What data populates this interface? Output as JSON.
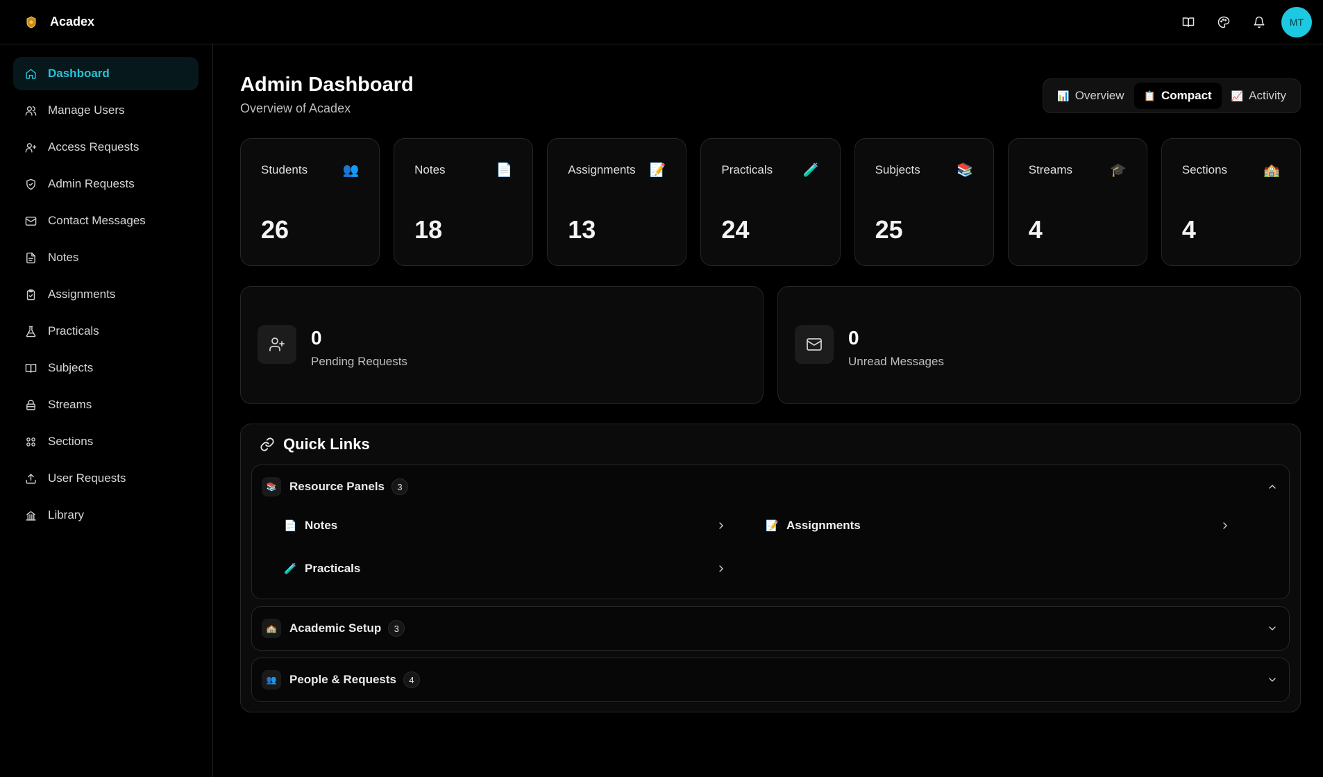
{
  "app": {
    "name": "Acadex",
    "avatar_initials": "MT",
    "accent_color": "#27c3d8",
    "avatar_color": "#1cc9e0"
  },
  "topbar": {
    "icons": [
      "book-icon",
      "palette-icon",
      "bell-icon"
    ]
  },
  "sidebar": {
    "items": [
      {
        "label": "Dashboard",
        "icon": "home-icon",
        "active": true
      },
      {
        "label": "Manage Users",
        "icon": "users-icon"
      },
      {
        "label": "Access Requests",
        "icon": "user-plus-icon"
      },
      {
        "label": "Admin Requests",
        "icon": "shield-icon"
      },
      {
        "label": "Contact Messages",
        "icon": "mail-icon"
      },
      {
        "label": "Notes",
        "icon": "file-icon"
      },
      {
        "label": "Assignments",
        "icon": "clipboard-icon"
      },
      {
        "label": "Practicals",
        "icon": "flask-icon"
      },
      {
        "label": "Subjects",
        "icon": "book-open-icon"
      },
      {
        "label": "Streams",
        "icon": "layers-icon"
      },
      {
        "label": "Sections",
        "icon": "grid-icon"
      },
      {
        "label": "User Requests",
        "icon": "upload-icon"
      },
      {
        "label": "Library",
        "icon": "building-icon"
      }
    ]
  },
  "header": {
    "title": "Admin Dashboard",
    "subtitle": "Overview of Acadex",
    "views": [
      {
        "label": "Overview",
        "icon": "📊"
      },
      {
        "label": "Compact",
        "icon": "📋",
        "active": true
      },
      {
        "label": "Activity",
        "icon": "📈"
      }
    ]
  },
  "stats": [
    {
      "label": "Students",
      "value": "26",
      "icon": "👥"
    },
    {
      "label": "Notes",
      "value": "18",
      "icon": "📄"
    },
    {
      "label": "Assignments",
      "value": "13",
      "icon": "📝"
    },
    {
      "label": "Practicals",
      "value": "24",
      "icon": "🧪"
    },
    {
      "label": "Subjects",
      "value": "25",
      "icon": "📚"
    },
    {
      "label": "Streams",
      "value": "4",
      "icon": "🎓"
    },
    {
      "label": "Sections",
      "value": "4",
      "icon": "🏫"
    }
  ],
  "summary": [
    {
      "value": "0",
      "label": "Pending Requests",
      "icon": "user-plus-icon"
    },
    {
      "value": "0",
      "label": "Unread Messages",
      "icon": "mail-icon"
    }
  ],
  "quick_links": {
    "title": "Quick Links",
    "sections": [
      {
        "label": "Resource Panels",
        "count": "3",
        "icon": "📚",
        "expanded": true,
        "links": [
          {
            "label": "Notes",
            "icon": "📄"
          },
          {
            "label": "Assignments",
            "icon": "📝"
          },
          {
            "label": "Practicals",
            "icon": "🧪"
          }
        ]
      },
      {
        "label": "Academic Setup",
        "count": "3",
        "icon": "🏫",
        "expanded": false
      },
      {
        "label": "People & Requests",
        "count": "4",
        "icon": "👥",
        "expanded": false
      }
    ]
  }
}
